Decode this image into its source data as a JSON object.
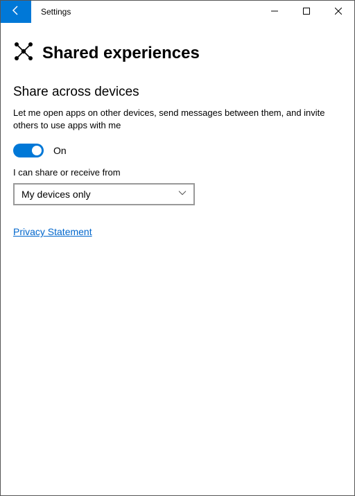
{
  "titlebar": {
    "app_name": "Settings"
  },
  "page": {
    "title": "Shared experiences"
  },
  "section": {
    "heading": "Share across devices",
    "description": "Let me open apps on other devices, send messages between them, and invite others to use apps with me"
  },
  "toggle": {
    "state_label": "On"
  },
  "receive": {
    "label": "I can share or receive from",
    "selected": "My devices only"
  },
  "links": {
    "privacy": "Privacy Statement"
  }
}
